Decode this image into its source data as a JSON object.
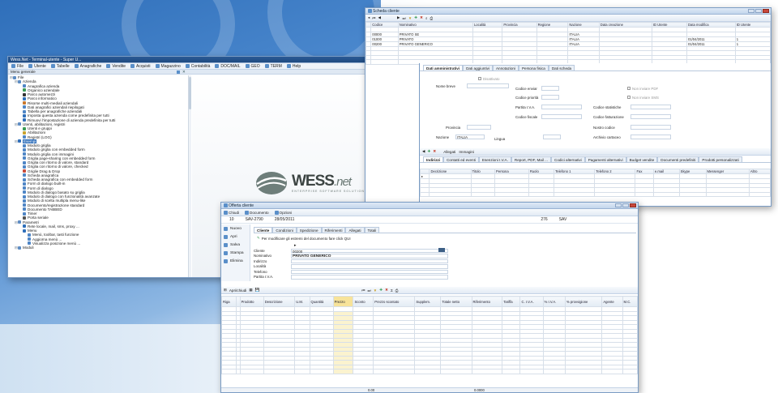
{
  "brand": {
    "name": "WESS",
    "suffix": ".net",
    "tagline": "ENTERPRISE SOFTWARE SOLUTION"
  },
  "main": {
    "title": "Wess.Net - Terminal-utente - Super U...",
    "menu": [
      "File",
      "Utente",
      "Tabelle",
      "Anagrafiche",
      "Vendite",
      "Acquisti",
      "Magazzino",
      "Contabilità",
      "DOC/MAIL",
      "GEO",
      "TERM",
      "Help"
    ],
    "panel_title": "Menu generale",
    "tree": [
      {
        "t": "File",
        "d": 0,
        "c": "#5d8cc4"
      },
      {
        "t": "Azienda",
        "d": 1,
        "c": "#5d8cc4"
      },
      {
        "t": "Anagrafica azienda",
        "d": 2,
        "c": "#4f86c6"
      },
      {
        "t": "Organico aziendale",
        "d": 2,
        "c": "#3a9b57"
      },
      {
        "t": "Parco automezzi",
        "d": 2,
        "c": "#333"
      },
      {
        "t": "Parco informatico",
        "d": 2,
        "c": "#2f6fba"
      },
      {
        "t": "Risorse multi-mediali aziendali",
        "d": 2,
        "c": "#c8782d"
      },
      {
        "t": "Dati anagrafici aziendali riepilogati",
        "d": 2,
        "c": "#4f86c6"
      },
      {
        "t": "Tabella per anagrafiche aziendali",
        "d": 2,
        "c": "#4f86c6"
      },
      {
        "t": "Imposta questa azienda come predefinita per tutti",
        "d": 2,
        "c": "#2f6fba"
      },
      {
        "t": "Rimuovi l'impostazione di azienda predefinita per tutti",
        "d": 2,
        "c": "#2f6fba"
      },
      {
        "t": "Utenti, abilitazioni, registri",
        "d": 1,
        "c": "#5d8cc4"
      },
      {
        "t": "Utenti e gruppi",
        "d": 2,
        "c": "#3a9b57"
      },
      {
        "t": "Abilitazioni",
        "d": 2,
        "c": "#c8a22d"
      },
      {
        "t": "Registri (LOG)",
        "d": 2,
        "c": "#4f86c6"
      },
      {
        "t": "Esempi",
        "d": 1,
        "c": "#2f6fba",
        "sel": true
      },
      {
        "t": "Modulo griglia",
        "d": 2,
        "c": "#4f86c6"
      },
      {
        "t": "Modulo griglia con embedded form",
        "d": 2,
        "c": "#4f86c6"
      },
      {
        "t": "Modulo griglia con immagini",
        "d": 2,
        "c": "#4f86c6"
      },
      {
        "t": "Griglia page-sharing con embedded form",
        "d": 2,
        "c": "#4f86c6"
      },
      {
        "t": "Griglia con ritorno di valore, standard",
        "d": 2,
        "c": "#4f86c6"
      },
      {
        "t": "Griglia con ritorno di valore, checked",
        "d": 2,
        "c": "#4f86c6"
      },
      {
        "t": "Griglie Drag & Drop",
        "d": 2,
        "c": "#c84a3a"
      },
      {
        "t": "Scheda anagrafica",
        "d": 2,
        "c": "#4f86c6"
      },
      {
        "t": "Scheda anagrafica con embedded form",
        "d": 2,
        "c": "#4f86c6"
      },
      {
        "t": "Form di dialogo built-in",
        "d": 2,
        "c": "#4f86c6"
      },
      {
        "t": "Form di dialogo",
        "d": 2,
        "c": "#4f86c6"
      },
      {
        "t": "Modulo di dialogo basato su griglia",
        "d": 2,
        "c": "#4f86c6"
      },
      {
        "t": "Modulo di dialogo con funzionalità avanzate",
        "d": 2,
        "c": "#4f86c6"
      },
      {
        "t": "Modulo di scelta multipla menu-like",
        "d": 2,
        "c": "#4f86c6"
      },
      {
        "t": "Documento/registrazione standard",
        "d": 2,
        "c": "#4f86c6"
      },
      {
        "t": "Documento TABBED",
        "d": 2,
        "c": "#4f86c6"
      },
      {
        "t": "Timer",
        "d": 2,
        "c": "#4f86c6"
      },
      {
        "t": "Porta seriale",
        "d": 2,
        "c": "#555"
      },
      {
        "t": "Parametri",
        "d": 1,
        "c": "#5d8cc4"
      },
      {
        "t": "Rete locale, mail, sms, proxy ...",
        "d": 2,
        "c": "#2f6fba"
      },
      {
        "t": "Menu",
        "d": 2,
        "c": "#2f6fba"
      },
      {
        "t": "Menù, toolbar, tasti funzione",
        "d": 3,
        "c": "#4f86c6"
      },
      {
        "t": "Aggiorna menù ...",
        "d": 3,
        "c": "#4f86c6"
      },
      {
        "t": "Visualizza posizione menù ...",
        "d": 3,
        "c": "#4f86c6"
      },
      {
        "t": "Moduli",
        "d": 1,
        "c": "#5d8cc4"
      }
    ]
  },
  "scheda": {
    "title": "Scheda cliente",
    "cols": [
      "Codice",
      "Nominativo",
      "Località",
      "Provincia",
      "Regione",
      "Nazione",
      "Data creazione",
      "ID Utente",
      "Data modifica",
      "ID Utente"
    ],
    "rows": [
      [
        "00000",
        "PRIVATO SE",
        "",
        "",
        "",
        "ITALIA",
        "",
        "",
        "",
        ""
      ],
      [
        "01000",
        "PRIVATO",
        "",
        "",
        "",
        "ITALIA",
        "",
        "",
        "01/04/2011",
        "1"
      ],
      [
        "00200",
        "PRIVATO GENERICO",
        "",
        "",
        "",
        "ITALIA",
        "",
        "",
        "01/04/2011",
        "1"
      ]
    ],
    "tabs": [
      "Dati amministrativi",
      "Dati aggiuntivi",
      "Annotazioni",
      "Persona fisica",
      "Dati scheda"
    ],
    "fields": {
      "disattivato": "Disattivato",
      "nome_breve": "Nome breve",
      "codice_enviar": "Codice enviar",
      "codice_priorita": "Codice priorità",
      "partita_iva": "Partita I.V.A.",
      "codice_fiscale": "Codice fiscale",
      "provincia": "Provincia",
      "nazione": "Nazione",
      "nazione_val": "ITALIA",
      "lingua": "Lingua",
      "codice_statistiche": "Codice statistiche",
      "codice_fatturazione": "Codice fatturazione",
      "nostro_codice": "Nostro codice",
      "archivio_cartaceo": "Archivio cartaceo",
      "non_inviare_pdf": "Non inviare PDF",
      "non_inviare_sms": "Non inviare SMS"
    },
    "subtabs": [
      "Allegati",
      "Immagini"
    ],
    "subtabs2": [
      "Indirizzi",
      "Contatti ed eventi",
      "Esenzioni I.V.A.",
      "Report, PDF, Mail ...",
      "Codici alternativi",
      "Pagamenti alternativi",
      "Budget vendite",
      "Documenti predefiniti",
      "Prodotti personalizzati"
    ],
    "cols2": [
      "Decrizione",
      "Titolo",
      "Persona",
      "Ruolo",
      "Telefono 1",
      "Telefono 2",
      "Fax",
      "e.mail",
      "Skype",
      "Messenger",
      "Altro"
    ]
  },
  "offerta": {
    "title": "Offerta cliente",
    "toolbar": [
      "Chiudi",
      "Documento",
      "Opzioni"
    ],
    "num": "10",
    "serie": "SAV-2790",
    "date": "28/05/2011",
    "ref": "276",
    "ref2": "SAV",
    "side": [
      "Nuovo",
      "Apri",
      "Salva",
      "Stampa",
      "Elimina"
    ],
    "tabs": [
      "Cliente",
      "Condizioni",
      "Spedizione",
      "Riferimenti",
      "Allegati",
      "Totali"
    ],
    "notice": "Per modificare gli estremi del documento fare click QUI",
    "fields": [
      [
        "Cliente",
        "00200"
      ],
      [
        "Nominativo",
        "PRIVATO GENERICO"
      ],
      [
        "Indirizzo",
        ""
      ],
      [
        "Località",
        ""
      ],
      [
        "Telefono",
        ""
      ],
      [
        "Partita I.V.A.",
        ""
      ]
    ],
    "grid_toolbar": "Apri/chiudi",
    "cols": [
      "Riga",
      "",
      "Prodotto",
      "Descrizione",
      "U.M.",
      "Quantità",
      "Prezzo",
      "Sconto",
      "Prezzo scontato",
      "Supplem.",
      "Totale netto",
      "Riferimento",
      "Tariffa",
      "C. I.V.A.",
      "% I.V.A.",
      "% provvigione",
      "Agente",
      "M.C."
    ],
    "totals": {
      "quantita": "0.00",
      "totale": "0.0000"
    }
  }
}
